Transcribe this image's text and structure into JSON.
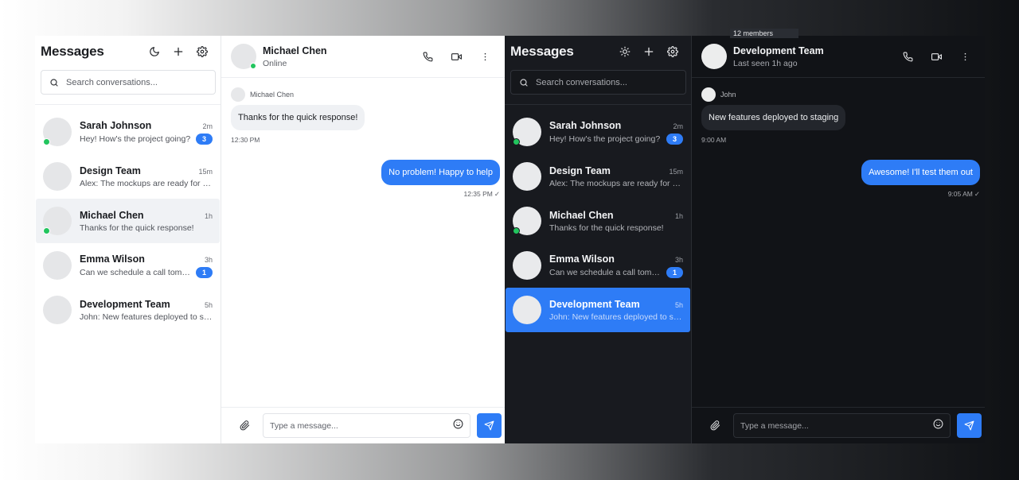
{
  "light": {
    "sidebar": {
      "title": "Messages",
      "theme_icon": "moon-icon",
      "search_placeholder": "Search conversations...",
      "conversations": [
        {
          "name": "Sarah Johnson",
          "time": "2m",
          "preview": "Hey! How's the project going?",
          "unread": "3",
          "online": true
        },
        {
          "name": "Design Team",
          "time": "15m",
          "preview": "Alex: The mockups are ready for review",
          "unread": "",
          "online": false
        },
        {
          "name": "Michael Chen",
          "time": "1h",
          "preview": "Thanks for the quick response!",
          "unread": "",
          "online": true,
          "active": true
        },
        {
          "name": "Emma Wilson",
          "time": "3h",
          "preview": "Can we schedule a call tomorrow?",
          "unread": "1",
          "online": false
        },
        {
          "name": "Development Team",
          "time": "5h",
          "preview": "John: New features deployed to staging",
          "unread": "",
          "online": false
        }
      ]
    },
    "chat": {
      "name": "Michael Chen",
      "status": "Online",
      "incoming": {
        "sender": "Michael Chen",
        "text": "Thanks for the quick response!",
        "time": "12:30 PM"
      },
      "outgoing": {
        "text": "No problem! Happy to help",
        "time": "12:35 PM",
        "check": "✓"
      },
      "composer_placeholder": "Type a message..."
    }
  },
  "dark": {
    "sidebar": {
      "title": "Messages",
      "theme_icon": "sun-icon",
      "search_placeholder": "Search conversations...",
      "conversations": [
        {
          "name": "Sarah Johnson",
          "time": "2m",
          "preview": "Hey! How's the project going?",
          "unread": "3",
          "online": true
        },
        {
          "name": "Design Team",
          "time": "15m",
          "preview": "Alex: The mockups are ready for review",
          "unread": "",
          "online": false
        },
        {
          "name": "Michael Chen",
          "time": "1h",
          "preview": "Thanks for the quick response!",
          "unread": "",
          "online": true
        },
        {
          "name": "Emma Wilson",
          "time": "3h",
          "preview": "Can we schedule a call tomorrow?",
          "unread": "1",
          "online": false
        },
        {
          "name": "Development Team",
          "time": "5h",
          "preview": "John: New features deployed to staging",
          "unread": "",
          "online": false,
          "active": true
        }
      ]
    },
    "chat": {
      "name": "Development Team",
      "status": "Last seen 1h ago",
      "tooltip": "12 members",
      "incoming": {
        "sender": "John",
        "text": "New features deployed to staging",
        "time": "9:00 AM"
      },
      "outgoing": {
        "text": "Awesome! I'll test them out",
        "time": "9:05 AM",
        "check": "✓"
      },
      "composer_placeholder": "Type a message..."
    }
  },
  "colors": {
    "accent": "#2e7cf6",
    "online": "#22c55e",
    "dark_bg": "#111317",
    "dark_sidebar": "#181a1f"
  }
}
